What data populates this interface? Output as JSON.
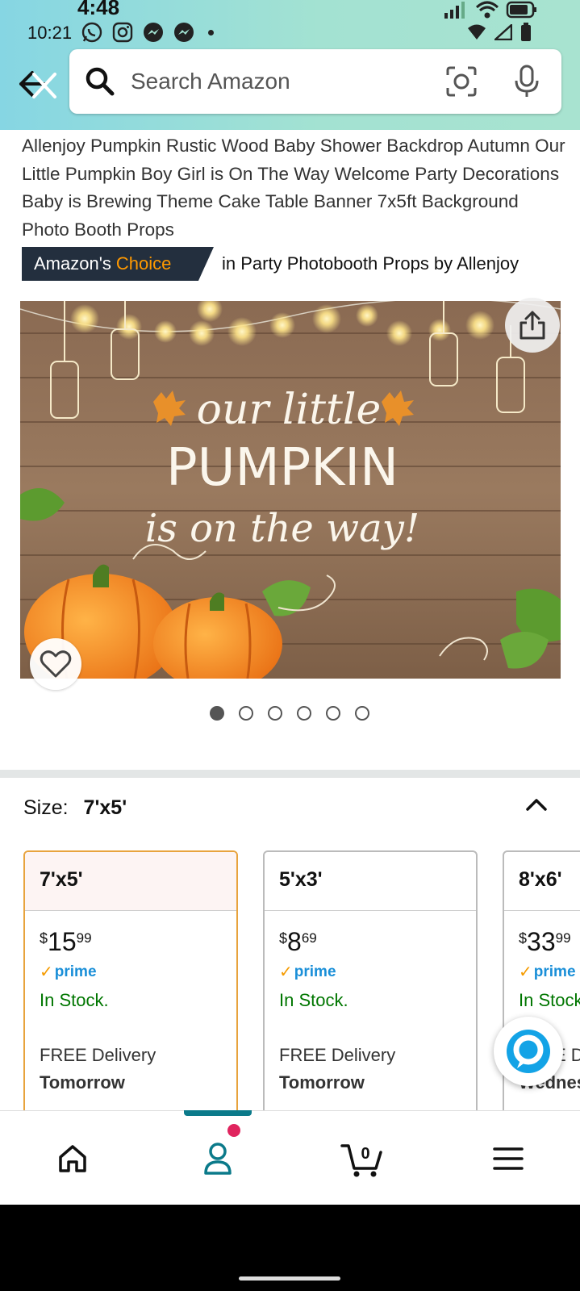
{
  "status_bar": {
    "time_large": "4:48",
    "time": "10:21"
  },
  "search": {
    "placeholder": "Search Amazon"
  },
  "product": {
    "title": "Allenjoy Pumpkin Rustic Wood Baby Shower Backdrop Autumn Our Little Pumpkin Boy Girl is On The Way Welcome Party Decorations Baby is Brewing Theme Cake Table Banner 7x5ft Background Photo Booth Props",
    "badge_prefix": "Amazon's",
    "badge_highlight": "Choice",
    "badge_category": "in Party Photobooth Props by Allenjoy",
    "image_text": {
      "line1": "our little",
      "line2": "PUMPKIN",
      "line3": "is on the way!"
    },
    "image_count": 6,
    "active_image": 1
  },
  "size_section": {
    "label": "Size:",
    "selected": "7'x5'",
    "cards": [
      {
        "size": "7'x5'",
        "currency": "$",
        "whole": "15",
        "fraction": "99",
        "prime": "prime",
        "stock": "In Stock.",
        "delivery": "FREE Delivery",
        "day": "Tomorrow"
      },
      {
        "size": "5'x3'",
        "currency": "$",
        "whole": "8",
        "fraction": "69",
        "prime": "prime",
        "stock": "In Stock.",
        "delivery": "FREE Delivery",
        "day": "Tomorrow"
      },
      {
        "size": "8'x6'",
        "currency": "$",
        "whole": "33",
        "fraction": "99",
        "prime": "prime",
        "stock": "In Stock.",
        "delivery": "FREE Delivery",
        "day": "Wednesday"
      }
    ]
  },
  "bottom_nav": {
    "cart_count": "0",
    "items": [
      "home-icon",
      "account-icon",
      "cart-icon",
      "menu-icon"
    ]
  },
  "colors": {
    "header_gradient_start": "#86d6e3",
    "header_gradient_end": "#a8e3d0",
    "badge_bg": "#232f3e",
    "badge_orange": "#ff9900",
    "in_stock": "#007600",
    "prime_blue": "#1a8fd8",
    "selected_border": "#e8a33d",
    "nav_active": "#0b7a8a"
  }
}
